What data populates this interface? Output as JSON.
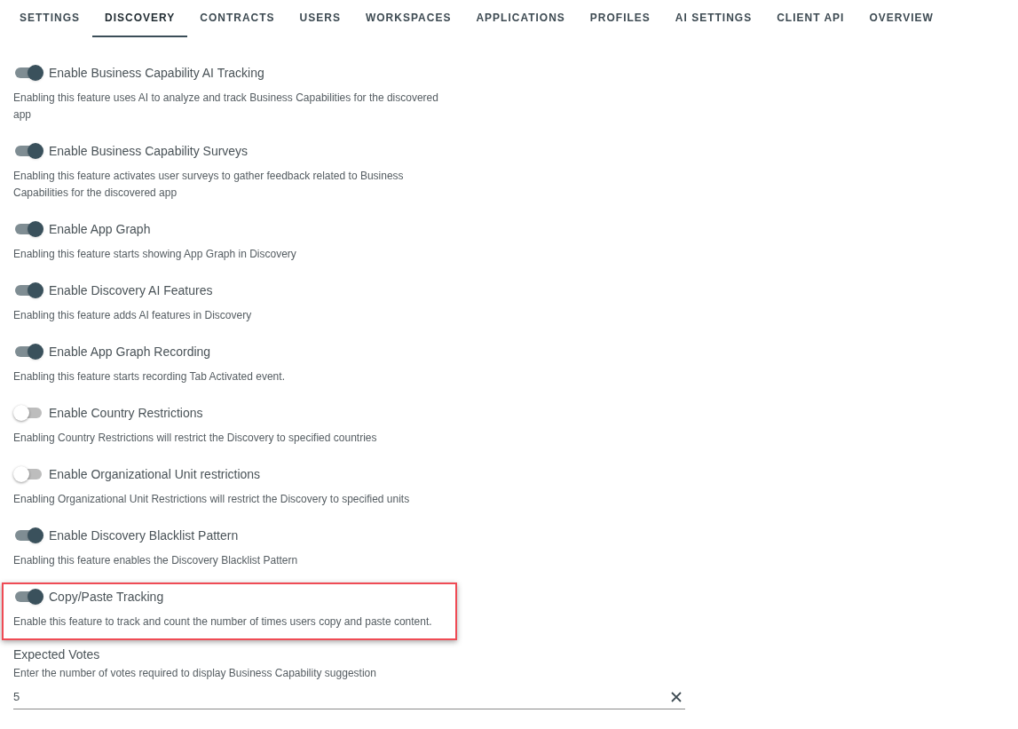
{
  "tabs": [
    {
      "label": "SETTINGS",
      "selected": false
    },
    {
      "label": "DISCOVERY",
      "selected": true
    },
    {
      "label": "CONTRACTS",
      "selected": false
    },
    {
      "label": "USERS",
      "selected": false
    },
    {
      "label": "WORKSPACES",
      "selected": false
    },
    {
      "label": "APPLICATIONS",
      "selected": false
    },
    {
      "label": "PROFILES",
      "selected": false
    },
    {
      "label": "AI SETTINGS",
      "selected": false
    },
    {
      "label": "CLIENT API",
      "selected": false
    },
    {
      "label": "OVERVIEW",
      "selected": false
    }
  ],
  "settings": [
    {
      "label": "Enable Business Capability AI Tracking",
      "description": "Enabling this feature uses AI to analyze and track Business Capabilities for the discovered app",
      "on": true,
      "highlighted": false
    },
    {
      "label": "Enable Business Capability Surveys",
      "description": "Enabling this feature activates user surveys to gather feedback related to Business Capabilities for the discovered app",
      "on": true,
      "highlighted": false
    },
    {
      "label": "Enable App Graph",
      "description": "Enabling this feature starts showing App Graph in Discovery",
      "on": true,
      "highlighted": false
    },
    {
      "label": "Enable Discovery AI Features",
      "description": "Enabling this feature adds AI features in Discovery",
      "on": true,
      "highlighted": false
    },
    {
      "label": "Enable App Graph Recording",
      "description": "Enabling this feature starts recording Tab Activated event.",
      "on": true,
      "highlighted": false
    },
    {
      "label": "Enable Country Restrictions",
      "description": "Enabling Country Restrictions will restrict the Discovery to specified countries",
      "on": false,
      "highlighted": false
    },
    {
      "label": "Enable Organizational Unit restrictions",
      "description": "Enabling Organizational Unit Restrictions will restrict the Discovery to specified units",
      "on": false,
      "highlighted": false
    },
    {
      "label": "Enable Discovery Blacklist Pattern",
      "description": "Enabling this feature enables the Discovery Blacklist Pattern",
      "on": true,
      "highlighted": false
    },
    {
      "label": "Copy/Paste Tracking",
      "description": "Enable this feature to track and count the number of times users copy and paste content.",
      "on": true,
      "highlighted": true
    }
  ],
  "expected_votes": {
    "label": "Expected Votes",
    "hint": "Enter the number of votes required to display Business Capability suggestion",
    "value": "5"
  }
}
